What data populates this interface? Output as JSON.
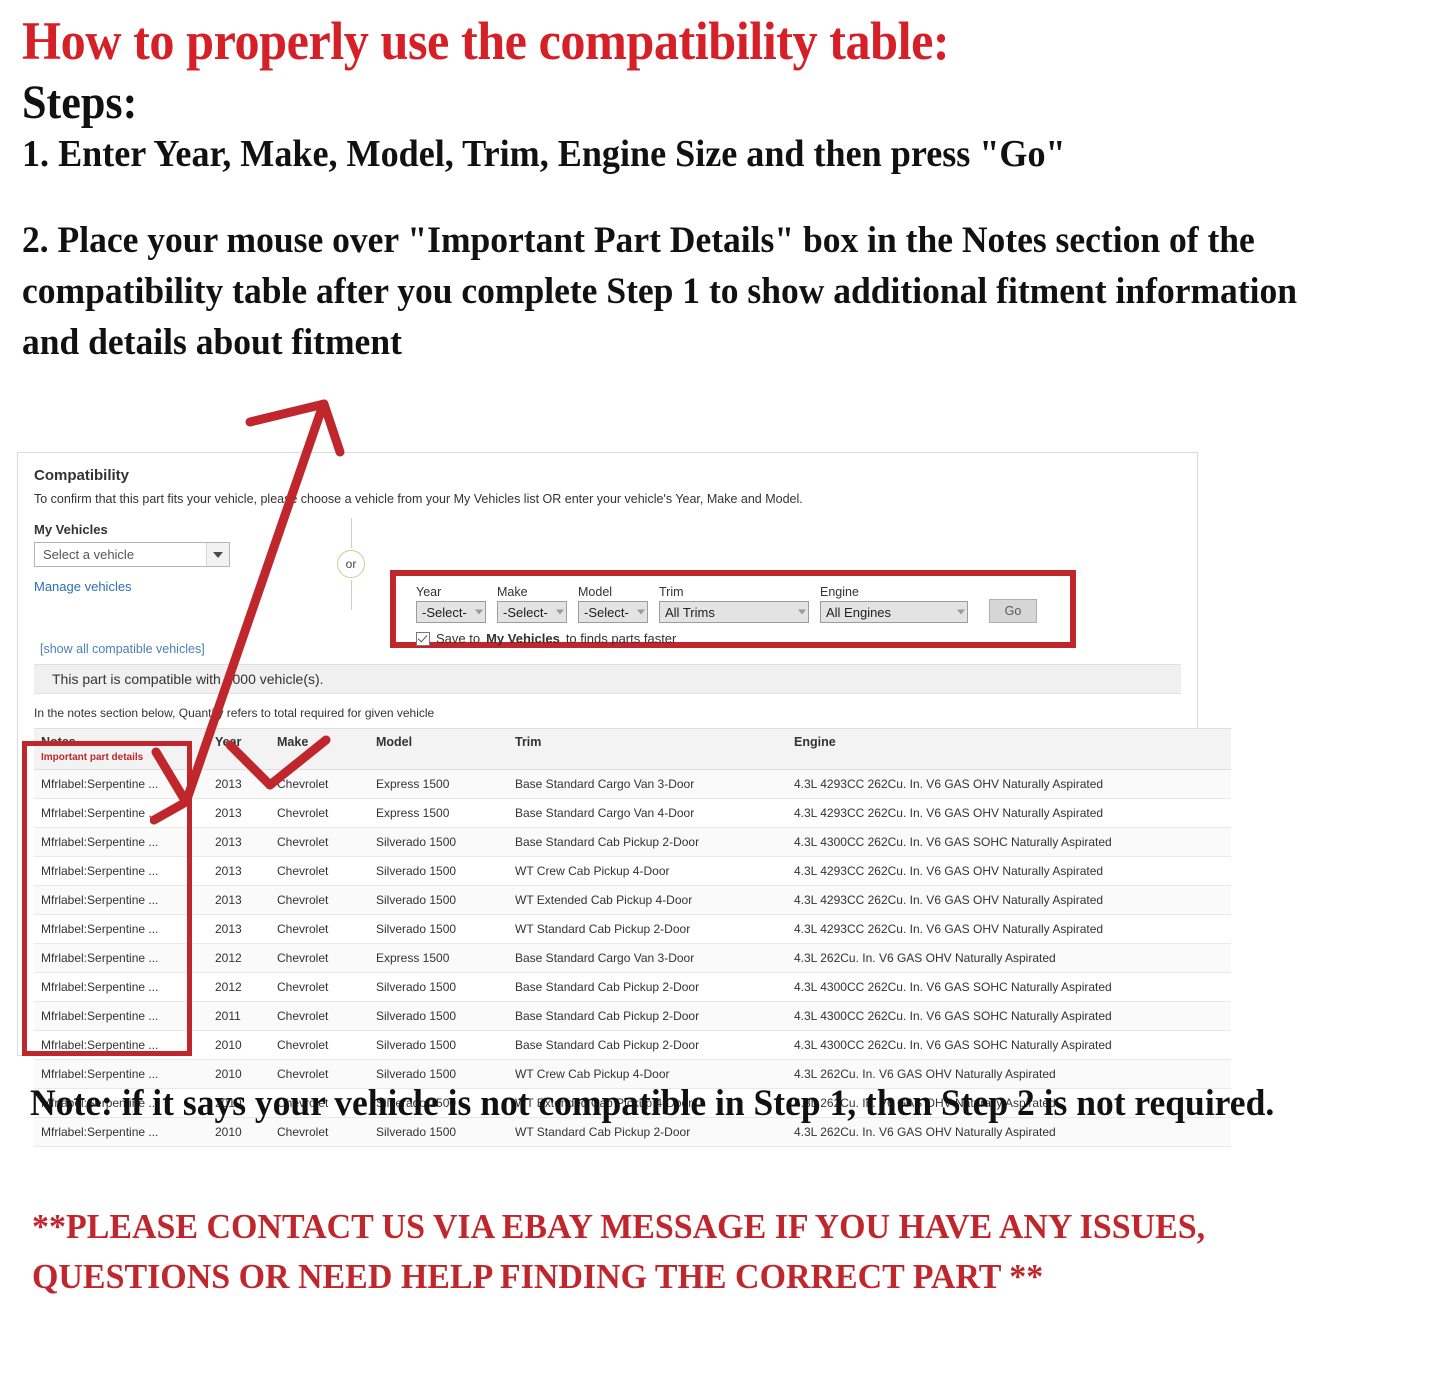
{
  "instructions": {
    "title": "How to properly use the compatibility table:",
    "steps_label": "Steps:",
    "step_one": "1. Enter Year, Make, Model, Trim, Engine Size and then press \"Go\"",
    "step_two": "2. Place your mouse over \"Important Part Details\" box in the Notes section of the compatibility table after you complete Step 1 to show additional fitment information and details about fitment",
    "bottom_note": "Note: if it says your vehicle is not compatible in Step 1, then Step 2 is not required.",
    "contact_note": "**PLEASE CONTACT US VIA EBAY MESSAGE IF YOU HAVE ANY ISSUES, QUESTIONS OR NEED HELP FINDING THE CORRECT PART **"
  },
  "colors": {
    "red_accent": "#c0272d",
    "title_red": "#d62027",
    "link_blue": "#2e6eb5",
    "or_gold": "#d9c98b"
  },
  "compatibility": {
    "heading": "Compatibility",
    "subheading": "To confirm that this part fits your vehicle, please choose a vehicle from your My Vehicles list OR enter your vehicle's Year, Make and Model.",
    "my_vehicles": {
      "label": "My Vehicles",
      "select_value": "Select a vehicle",
      "manage_link": "Manage vehicles"
    },
    "or_divider": "or",
    "finder": {
      "year": {
        "label": "Year",
        "value": "-Select-"
      },
      "make": {
        "label": "Make",
        "value": "-Select-"
      },
      "model": {
        "label": "Model",
        "value": "-Select-"
      },
      "trim": {
        "label": "Trim",
        "value": "All Trims"
      },
      "engine": {
        "label": "Engine",
        "value": "All Engines"
      },
      "go_button": "Go",
      "save_prefix": "Save to",
      "save_bold": "My Vehicles",
      "save_suffix": "to finds parts faster"
    },
    "show_all_link": "[show all compatible vehicles]",
    "compatible_banner": "This part is compatible with 1000 vehicle(s).",
    "quantity_note": "In the notes section below, Quantity refers to total required for given vehicle",
    "table": {
      "headers": {
        "notes": "Notes",
        "notes_sub": "Important part details",
        "year": "Year",
        "make": "Make",
        "model": "Model",
        "trim": "Trim",
        "engine": "Engine"
      },
      "rows": [
        {
          "notes": "Mfrlabel:Serpentine ...",
          "year": "2013",
          "make": "Chevrolet",
          "model": "Express 1500",
          "trim": "Base Standard Cargo Van 3-Door",
          "engine": "4.3L 4293CC 262Cu. In. V6 GAS OHV Naturally Aspirated"
        },
        {
          "notes": "Mfrlabel:Serpentine ...",
          "year": "2013",
          "make": "Chevrolet",
          "model": "Express 1500",
          "trim": "Base Standard Cargo Van 4-Door",
          "engine": "4.3L 4293CC 262Cu. In. V6 GAS OHV Naturally Aspirated"
        },
        {
          "notes": "Mfrlabel:Serpentine ...",
          "year": "2013",
          "make": "Chevrolet",
          "model": "Silverado 1500",
          "trim": "Base Standard Cab Pickup 2-Door",
          "engine": "4.3L 4300CC 262Cu. In. V6 GAS SOHC Naturally Aspirated"
        },
        {
          "notes": "Mfrlabel:Serpentine ...",
          "year": "2013",
          "make": "Chevrolet",
          "model": "Silverado 1500",
          "trim": "WT Crew Cab Pickup 4-Door",
          "engine": "4.3L 4293CC 262Cu. In. V6 GAS OHV Naturally Aspirated"
        },
        {
          "notes": "Mfrlabel:Serpentine ...",
          "year": "2013",
          "make": "Chevrolet",
          "model": "Silverado 1500",
          "trim": "WT Extended Cab Pickup 4-Door",
          "engine": "4.3L 4293CC 262Cu. In. V6 GAS OHV Naturally Aspirated"
        },
        {
          "notes": "Mfrlabel:Serpentine ...",
          "year": "2013",
          "make": "Chevrolet",
          "model": "Silverado 1500",
          "trim": "WT Standard Cab Pickup 2-Door",
          "engine": "4.3L 4293CC 262Cu. In. V6 GAS OHV Naturally Aspirated"
        },
        {
          "notes": "Mfrlabel:Serpentine ...",
          "year": "2012",
          "make": "Chevrolet",
          "model": "Express 1500",
          "trim": "Base Standard Cargo Van 3-Door",
          "engine": "4.3L 262Cu. In. V6 GAS OHV Naturally Aspirated"
        },
        {
          "notes": "Mfrlabel:Serpentine ...",
          "year": "2012",
          "make": "Chevrolet",
          "model": "Silverado 1500",
          "trim": "Base Standard Cab Pickup 2-Door",
          "engine": "4.3L 4300CC 262Cu. In. V6 GAS SOHC Naturally Aspirated"
        },
        {
          "notes": "Mfrlabel:Serpentine ...",
          "year": "2011",
          "make": "Chevrolet",
          "model": "Silverado 1500",
          "trim": "Base Standard Cab Pickup 2-Door",
          "engine": "4.3L 4300CC 262Cu. In. V6 GAS SOHC Naturally Aspirated"
        },
        {
          "notes": "Mfrlabel:Serpentine ...",
          "year": "2010",
          "make": "Chevrolet",
          "model": "Silverado 1500",
          "trim": "Base Standard Cab Pickup 2-Door",
          "engine": "4.3L 4300CC 262Cu. In. V6 GAS SOHC Naturally Aspirated"
        },
        {
          "notes": "Mfrlabel:Serpentine ...",
          "year": "2010",
          "make": "Chevrolet",
          "model": "Silverado 1500",
          "trim": "WT Crew Cab Pickup 4-Door",
          "engine": "4.3L 262Cu. In. V6 GAS OHV Naturally Aspirated"
        },
        {
          "notes": "Mfrlabel:Serpentine ...",
          "year": "2010",
          "make": "Chevrolet",
          "model": "Silverado 1500",
          "trim": "WT Extended Cab Pickup 4-Door",
          "engine": "4.3L 262Cu. In. V6 GAS OHV Naturally Aspirated"
        },
        {
          "notes": "Mfrlabel:Serpentine ...",
          "year": "2010",
          "make": "Chevrolet",
          "model": "Silverado 1500",
          "trim": "WT Standard Cab Pickup 2-Door",
          "engine": "4.3L 262Cu. In. V6 GAS OHV Naturally Aspirated"
        }
      ]
    }
  }
}
